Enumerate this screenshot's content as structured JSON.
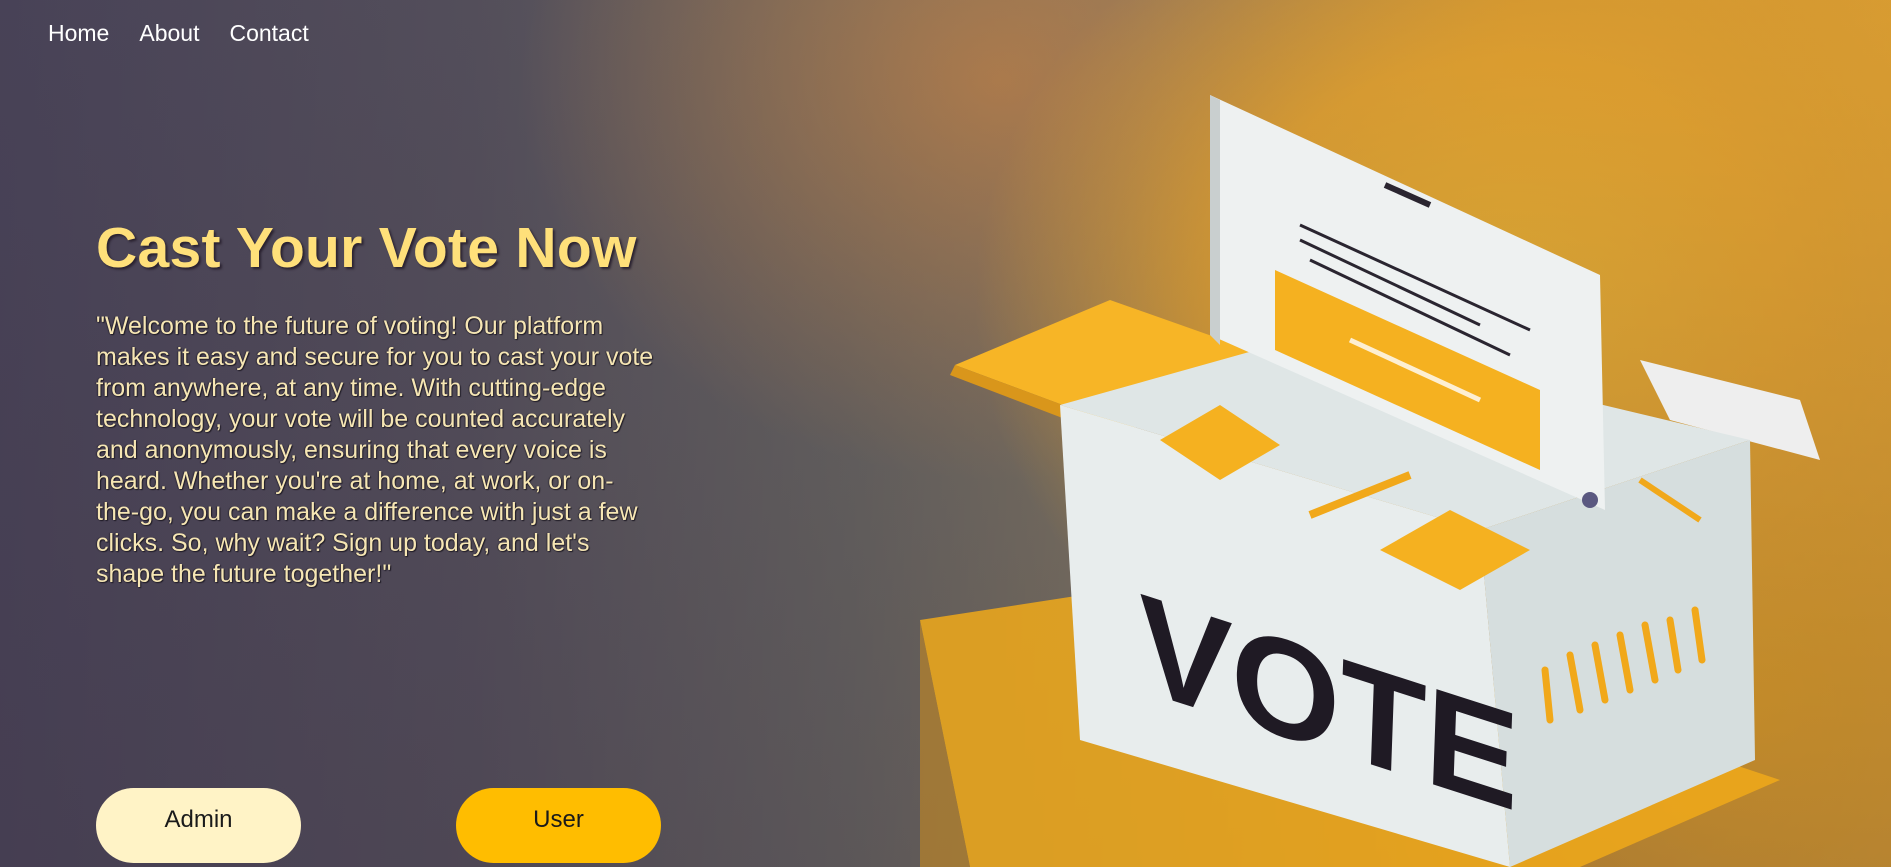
{
  "nav": {
    "items": [
      "Home",
      "About",
      "Contact"
    ]
  },
  "hero": {
    "title": "Cast Your Vote Now",
    "description": "\"Welcome to the future of voting! Our platform makes it easy and secure for you to cast your vote from anywhere, at any time. With cutting-edge technology, your vote will be counted accurately and anonymously, ensuring that every voice is heard. Whether you're at home, at work, or on-the-go, you can make a difference with just a few clicks. So, why wait? Sign up today, and let's shape the future together!\""
  },
  "buttons": {
    "admin_label": "Admin",
    "user_label": "User"
  },
  "illustration": {
    "box_label": "VOTE",
    "icon": "ballot-box-illustration"
  },
  "colors": {
    "title": "#ffe07a",
    "accent": "#ffbd00",
    "admin_button": "#fff3c6"
  }
}
